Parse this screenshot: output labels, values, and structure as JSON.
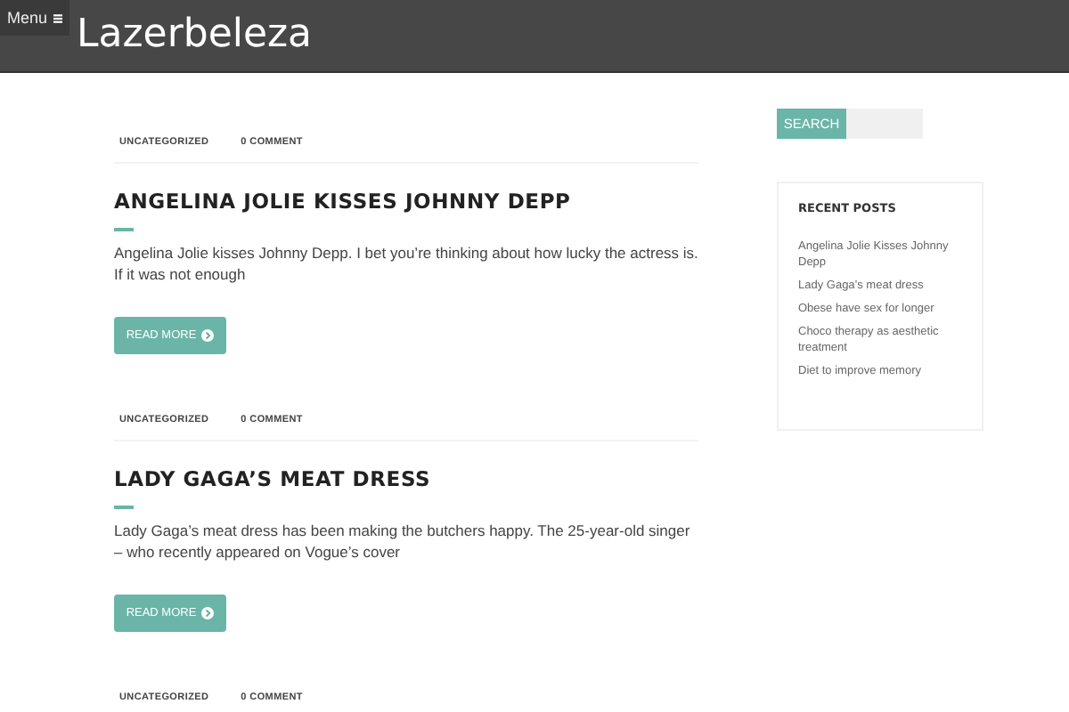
{
  "header": {
    "menu_label": "Menu",
    "site_title": "Lazerbeleza"
  },
  "posts": [
    {
      "category": "UNCATEGORIZED",
      "comments": "0 COMMENT",
      "title": "ANGELINA JOLIE KISSES JOHNNY DEPP",
      "excerpt": "Angelina Jolie kisses Johnny Depp. I bet you’re thinking about how lucky the actress is. If it was not enough",
      "button": "READ MORE"
    },
    {
      "category": "UNCATEGORIZED",
      "comments": "0 COMMENT",
      "title": "LADY GAGA’S MEAT DRESS",
      "excerpt": "Lady Gaga’s meat dress has been making the butchers happy. The 25-year-old singer – who recently appeared on Vogue’s cover",
      "button": "READ MORE"
    },
    {
      "category": "UNCATEGORIZED",
      "comments": "0 COMMENT"
    }
  ],
  "sidebar": {
    "search_button": "SEARCH",
    "recent_title": "RECENT POSTS",
    "recent_posts": [
      "Angelina Jolie Kisses Johnny Depp",
      "Lady Gaga’s meat dress",
      "Obese have sex for longer",
      "Choco therapy as aesthetic treatment",
      "Diet to improve memory"
    ]
  }
}
